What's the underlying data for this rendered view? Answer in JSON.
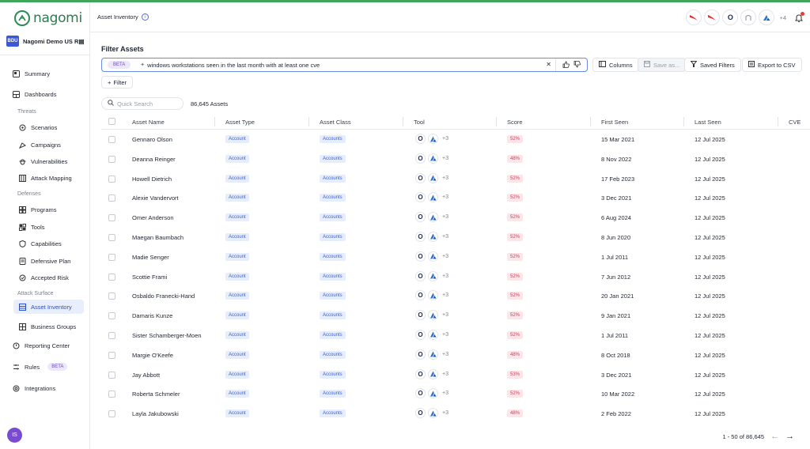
{
  "brand": {
    "logo_text": "nagomi",
    "accent": "#3fa65a"
  },
  "org": {
    "badge": "BDU",
    "name": "Nagomi Demo US R▤"
  },
  "sidebar": {
    "items": [
      {
        "label": "Summary",
        "icon": "summary-icon"
      },
      {
        "label": "Dashboards",
        "icon": "dashboard-icon"
      }
    ],
    "threats_label": "Threats",
    "threats": [
      {
        "label": "Scenarios",
        "icon": "scenarios-icon"
      },
      {
        "label": "Campaigns",
        "icon": "campaigns-icon"
      },
      {
        "label": "Vulnerabilities",
        "icon": "bug-icon"
      },
      {
        "label": "Attack Mapping",
        "icon": "attack-mapping-icon"
      }
    ],
    "defenses_label": "Defenses",
    "defenses": [
      {
        "label": "Programs",
        "icon": "programs-icon"
      },
      {
        "label": "Tools",
        "icon": "tools-icon"
      },
      {
        "label": "Capabilities",
        "icon": "shield-icon"
      },
      {
        "label": "Defensive Plan",
        "icon": "plan-icon"
      },
      {
        "label": "Accepted Risk",
        "icon": "risk-icon"
      }
    ],
    "attack_surface_label": "Attack Surface",
    "attack_surface": [
      {
        "label": "Asset Inventory",
        "icon": "inventory-icon",
        "active": true
      },
      {
        "label": "Business Groups",
        "icon": "groups-icon"
      }
    ],
    "reporting": "Reporting Center",
    "rules": "Rules",
    "rules_badge": "BETA",
    "integrations": "Integrations",
    "user_initials": "IS"
  },
  "header": {
    "title": "Asset Inventory",
    "tools_more": "+4"
  },
  "filter": {
    "title": "Filter Assets",
    "beta": "BETA",
    "query": "windows workstations seen in the last month with at least one cve",
    "add_filter": "Filter",
    "columns": "Columns",
    "save_as": "Save as...",
    "saved_filters": "Saved Filters",
    "export": "Export to CSV"
  },
  "list": {
    "quick_search_placeholder": "Quick Search",
    "count": "86,645 Assets",
    "columns": [
      "Asset Name",
      "Asset Type",
      "Asset Class",
      "Tool",
      "Score",
      "First Seen",
      "Last Seen",
      "CVE"
    ],
    "rows": [
      {
        "name": "Gennaro Olson",
        "type": "Account",
        "class": "Accounts",
        "tools_more": "+3",
        "score": "52%",
        "first": "15 Mar 2021",
        "last": "12 Jul 2025"
      },
      {
        "name": "Deanna Reinger",
        "type": "Account",
        "class": "Accounts",
        "tools_more": "+3",
        "score": "48%",
        "first": "8 Nov 2022",
        "last": "12 Jul 2025"
      },
      {
        "name": "Howell Dietrich",
        "type": "Account",
        "class": "Accounts",
        "tools_more": "+3",
        "score": "52%",
        "first": "17 Feb 2023",
        "last": "12 Jul 2025"
      },
      {
        "name": "Alexie Vandervort",
        "type": "Account",
        "class": "Accounts",
        "tools_more": "+3",
        "score": "52%",
        "first": "3 Dec 2021",
        "last": "12 Jul 2025"
      },
      {
        "name": "Omer Anderson",
        "type": "Account",
        "class": "Accounts",
        "tools_more": "+3",
        "score": "52%",
        "first": "6 Aug 2024",
        "last": "12 Jul 2025"
      },
      {
        "name": "Maegan Baumbach",
        "type": "Account",
        "class": "Accounts",
        "tools_more": "+3",
        "score": "52%",
        "first": "8 Jun 2020",
        "last": "12 Jul 2025"
      },
      {
        "name": "Madie Senger",
        "type": "Account",
        "class": "Accounts",
        "tools_more": "+3",
        "score": "52%",
        "first": "1 Jul 2011",
        "last": "12 Jul 2025"
      },
      {
        "name": "Scottie Frami",
        "type": "Account",
        "class": "Accounts",
        "tools_more": "+3",
        "score": "52%",
        "first": "7 Jun 2012",
        "last": "12 Jul 2025"
      },
      {
        "name": "Osbaldo Franecki-Hand",
        "type": "Account",
        "class": "Accounts",
        "tools_more": "+3",
        "score": "52%",
        "first": "20 Jan 2021",
        "last": "12 Jul 2025"
      },
      {
        "name": "Damaris Kunze",
        "type": "Account",
        "class": "Accounts",
        "tools_more": "+3",
        "score": "52%",
        "first": "9 Jan 2021",
        "last": "12 Jul 2025"
      },
      {
        "name": "Sister Schamberger-Moen",
        "type": "Account",
        "class": "Accounts",
        "tools_more": "+3",
        "score": "52%",
        "first": "1 Jul 2011",
        "last": "12 Jul 2025"
      },
      {
        "name": "Margie O'Keefe",
        "type": "Account",
        "class": "Accounts",
        "tools_more": "+3",
        "score": "48%",
        "first": "8 Oct 2018",
        "last": "12 Jul 2025"
      },
      {
        "name": "Jay Abbott",
        "type": "Account",
        "class": "Accounts",
        "tools_more": "+3",
        "score": "53%",
        "first": "3 Dec 2021",
        "last": "12 Jul 2025"
      },
      {
        "name": "Roberta Schmeler",
        "type": "Account",
        "class": "Accounts",
        "tools_more": "+3",
        "score": "52%",
        "first": "10 Mar 2022",
        "last": "12 Jul 2025"
      },
      {
        "name": "Layla Jakubowski",
        "type": "Account",
        "class": "Accounts",
        "tools_more": "+3",
        "score": "48%",
        "first": "2 Feb 2022",
        "last": "12 Jul 2025"
      }
    ]
  },
  "pagination": {
    "label": "1 - 50 of 86,645"
  }
}
